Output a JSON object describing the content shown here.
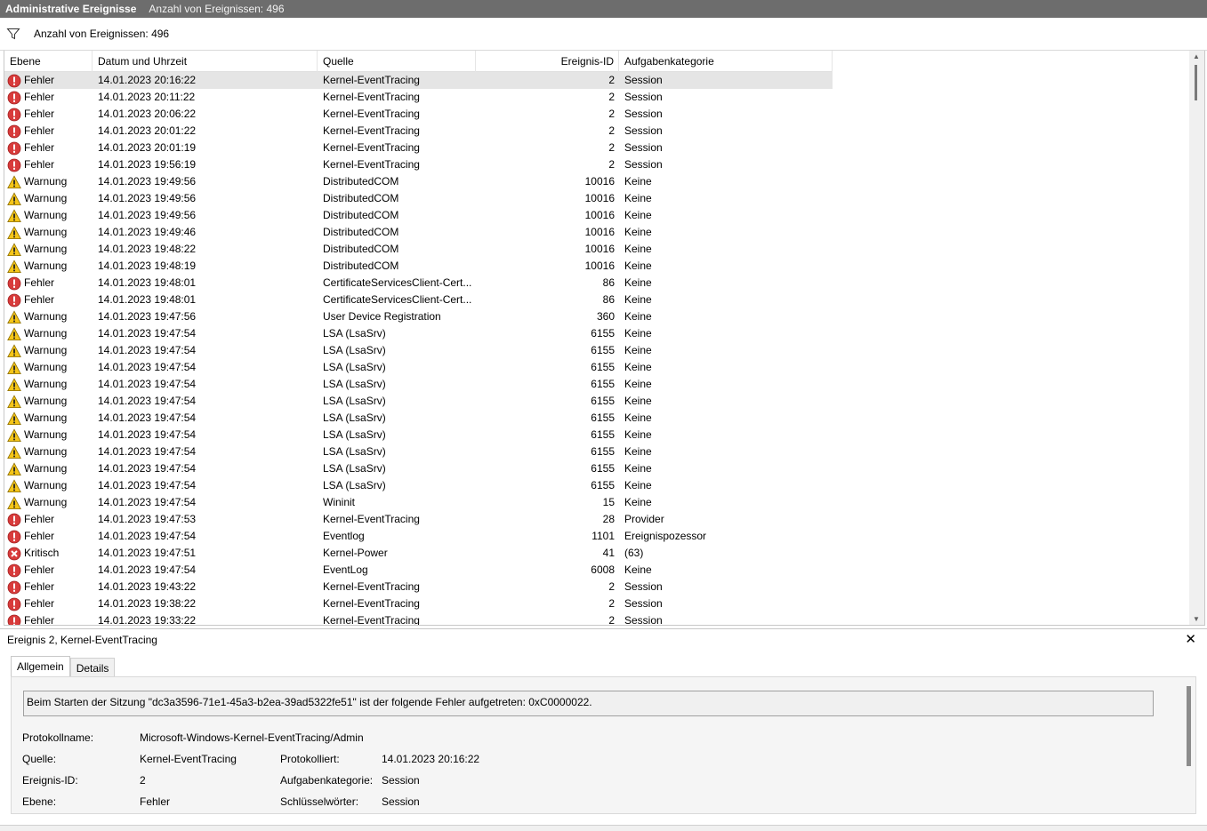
{
  "titlebar": {
    "title": "Administrative Ereignisse",
    "count": "Anzahl von Ereignissen: 496"
  },
  "filter": {
    "icon": "filter-icon",
    "text": "Anzahl von Ereignissen: 496"
  },
  "columns": {
    "level": "Ebene",
    "date": "Datum und Uhrzeit",
    "source": "Quelle",
    "id": "Ereignis-ID",
    "category": "Aufgabenkategorie"
  },
  "rows": [
    {
      "type": "error",
      "level": "Fehler",
      "date": "14.01.2023 20:16:22",
      "source": "Kernel-EventTracing",
      "id": "2",
      "category": "Session"
    },
    {
      "type": "error",
      "level": "Fehler",
      "date": "14.01.2023 20:11:22",
      "source": "Kernel-EventTracing",
      "id": "2",
      "category": "Session"
    },
    {
      "type": "error",
      "level": "Fehler",
      "date": "14.01.2023 20:06:22",
      "source": "Kernel-EventTracing",
      "id": "2",
      "category": "Session"
    },
    {
      "type": "error",
      "level": "Fehler",
      "date": "14.01.2023 20:01:22",
      "source": "Kernel-EventTracing",
      "id": "2",
      "category": "Session"
    },
    {
      "type": "error",
      "level": "Fehler",
      "date": "14.01.2023 20:01:19",
      "source": "Kernel-EventTracing",
      "id": "2",
      "category": "Session"
    },
    {
      "type": "error",
      "level": "Fehler",
      "date": "14.01.2023 19:56:19",
      "source": "Kernel-EventTracing",
      "id": "2",
      "category": "Session"
    },
    {
      "type": "warning",
      "level": "Warnung",
      "date": "14.01.2023 19:49:56",
      "source": "DistributedCOM",
      "id": "10016",
      "category": "Keine"
    },
    {
      "type": "warning",
      "level": "Warnung",
      "date": "14.01.2023 19:49:56",
      "source": "DistributedCOM",
      "id": "10016",
      "category": "Keine"
    },
    {
      "type": "warning",
      "level": "Warnung",
      "date": "14.01.2023 19:49:56",
      "source": "DistributedCOM",
      "id": "10016",
      "category": "Keine"
    },
    {
      "type": "warning",
      "level": "Warnung",
      "date": "14.01.2023 19:49:46",
      "source": "DistributedCOM",
      "id": "10016",
      "category": "Keine"
    },
    {
      "type": "warning",
      "level": "Warnung",
      "date": "14.01.2023 19:48:22",
      "source": "DistributedCOM",
      "id": "10016",
      "category": "Keine"
    },
    {
      "type": "warning",
      "level": "Warnung",
      "date": "14.01.2023 19:48:19",
      "source": "DistributedCOM",
      "id": "10016",
      "category": "Keine"
    },
    {
      "type": "error",
      "level": "Fehler",
      "date": "14.01.2023 19:48:01",
      "source": "CertificateServicesClient-Cert...",
      "id": "86",
      "category": "Keine"
    },
    {
      "type": "error",
      "level": "Fehler",
      "date": "14.01.2023 19:48:01",
      "source": "CertificateServicesClient-Cert...",
      "id": "86",
      "category": "Keine"
    },
    {
      "type": "warning",
      "level": "Warnung",
      "date": "14.01.2023 19:47:56",
      "source": "User Device Registration",
      "id": "360",
      "category": "Keine"
    },
    {
      "type": "warning",
      "level": "Warnung",
      "date": "14.01.2023 19:47:54",
      "source": "LSA (LsaSrv)",
      "id": "6155",
      "category": "Keine"
    },
    {
      "type": "warning",
      "level": "Warnung",
      "date": "14.01.2023 19:47:54",
      "source": "LSA (LsaSrv)",
      "id": "6155",
      "category": "Keine"
    },
    {
      "type": "warning",
      "level": "Warnung",
      "date": "14.01.2023 19:47:54",
      "source": "LSA (LsaSrv)",
      "id": "6155",
      "category": "Keine"
    },
    {
      "type": "warning",
      "level": "Warnung",
      "date": "14.01.2023 19:47:54",
      "source": "LSA (LsaSrv)",
      "id": "6155",
      "category": "Keine"
    },
    {
      "type": "warning",
      "level": "Warnung",
      "date": "14.01.2023 19:47:54",
      "source": "LSA (LsaSrv)",
      "id": "6155",
      "category": "Keine"
    },
    {
      "type": "warning",
      "level": "Warnung",
      "date": "14.01.2023 19:47:54",
      "source": "LSA (LsaSrv)",
      "id": "6155",
      "category": "Keine"
    },
    {
      "type": "warning",
      "level": "Warnung",
      "date": "14.01.2023 19:47:54",
      "source": "LSA (LsaSrv)",
      "id": "6155",
      "category": "Keine"
    },
    {
      "type": "warning",
      "level": "Warnung",
      "date": "14.01.2023 19:47:54",
      "source": "LSA (LsaSrv)",
      "id": "6155",
      "category": "Keine"
    },
    {
      "type": "warning",
      "level": "Warnung",
      "date": "14.01.2023 19:47:54",
      "source": "LSA (LsaSrv)",
      "id": "6155",
      "category": "Keine"
    },
    {
      "type": "warning",
      "level": "Warnung",
      "date": "14.01.2023 19:47:54",
      "source": "LSA (LsaSrv)",
      "id": "6155",
      "category": "Keine"
    },
    {
      "type": "warning",
      "level": "Warnung",
      "date": "14.01.2023 19:47:54",
      "source": "Wininit",
      "id": "15",
      "category": "Keine"
    },
    {
      "type": "error",
      "level": "Fehler",
      "date": "14.01.2023 19:47:53",
      "source": "Kernel-EventTracing",
      "id": "28",
      "category": "Provider"
    },
    {
      "type": "error",
      "level": "Fehler",
      "date": "14.01.2023 19:47:54",
      "source": "Eventlog",
      "id": "1101",
      "category": "Ereignispozessor"
    },
    {
      "type": "critical",
      "level": "Kritisch",
      "date": "14.01.2023 19:47:51",
      "source": "Kernel-Power",
      "id": "41",
      "category": "(63)"
    },
    {
      "type": "error",
      "level": "Fehler",
      "date": "14.01.2023 19:47:54",
      "source": "EventLog",
      "id": "6008",
      "category": "Keine"
    },
    {
      "type": "error",
      "level": "Fehler",
      "date": "14.01.2023 19:43:22",
      "source": "Kernel-EventTracing",
      "id": "2",
      "category": "Session"
    },
    {
      "type": "error",
      "level": "Fehler",
      "date": "14.01.2023 19:38:22",
      "source": "Kernel-EventTracing",
      "id": "2",
      "category": "Session"
    },
    {
      "type": "error",
      "level": "Fehler",
      "date": "14.01.2023 19:33:22",
      "source": "Kernel-EventTracing",
      "id": "2",
      "category": "Session"
    }
  ],
  "detail": {
    "title": "Ereignis 2, Kernel-EventTracing",
    "tabs": [
      "Allgemein",
      "Details"
    ],
    "message": "Beim Starten der Sitzung \"dc3a3596-71e1-45a3-b2ea-39ad5322fe51\" ist der folgende Fehler aufgetreten: 0xC0000022.",
    "protokollname_label": "Protokollname:",
    "protokollname": "Microsoft-Windows-Kernel-EventTracing/Admin",
    "quelle_label": "Quelle:",
    "quelle": "Kernel-EventTracing",
    "protokolliert_label": "Protokolliert:",
    "protokolliert": "14.01.2023 20:16:22",
    "ereignis_id_label": "Ereignis-ID:",
    "ereignis_id": "2",
    "aufgabenkategorie_label": "Aufgabenkategorie:",
    "aufgabenkategorie": "Session",
    "ebene_label": "Ebene:",
    "ebene": "Fehler",
    "schluesselwoerter_label": "Schlüsselwörter:",
    "schluesselwoerter": "Session"
  },
  "icons": {
    "error": "error-icon",
    "warning": "warning-icon",
    "critical": "critical-icon",
    "close": "close-icon"
  },
  "colors": {
    "titlebar": "#6d6d6d",
    "error": "#d83b3b",
    "warning": "#f5c518",
    "selected_row": "#e5e5e5"
  }
}
